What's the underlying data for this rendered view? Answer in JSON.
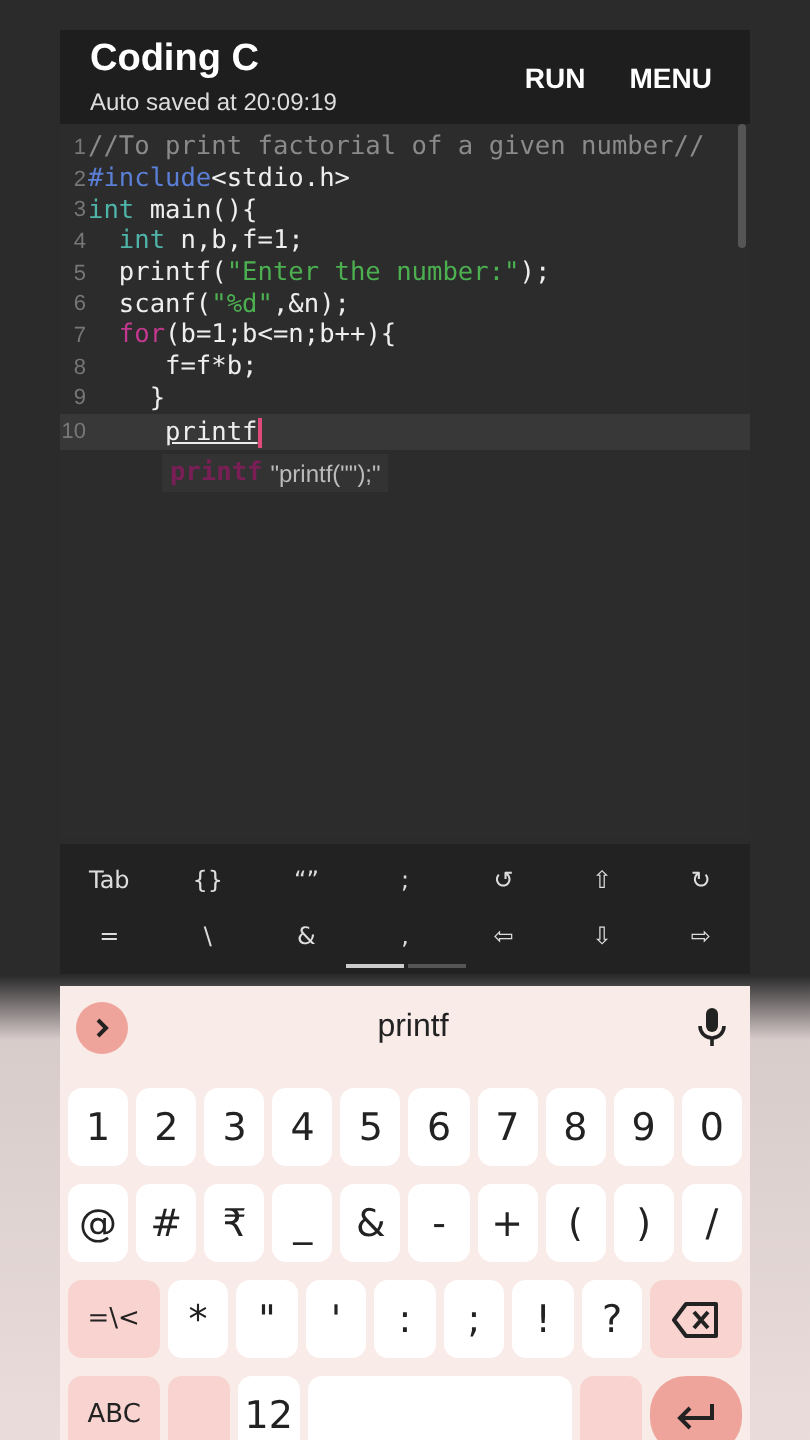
{
  "app_bar": {
    "title": "Coding C",
    "subtitle": "Auto saved at 20:09:19",
    "actions": [
      "RUN",
      "MENU"
    ]
  },
  "editor": {
    "lines": [
      {
        "number": "1",
        "current": false,
        "tokens": [
          {
            "text": "//To print factorial of a given number//",
            "kind": "comment"
          }
        ]
      },
      {
        "number": "2",
        "current": false,
        "tokens": [
          {
            "text": "#include",
            "kind": "preprocessor"
          },
          {
            "text": "<stdio.h>",
            "kind": "plain"
          }
        ]
      },
      {
        "number": "3",
        "current": false,
        "tokens": [
          {
            "text": "int",
            "kind": "type"
          },
          {
            "text": " main(){",
            "kind": "plain"
          }
        ]
      },
      {
        "number": "4",
        "current": false,
        "tokens": [
          {
            "text": "  int",
            "kind": "type"
          },
          {
            "text": " n,b,f=1;",
            "kind": "plain"
          }
        ]
      },
      {
        "number": "5",
        "current": false,
        "tokens": [
          {
            "text": "  printf(",
            "kind": "plain"
          },
          {
            "text": "\"Enter the number:\"",
            "kind": "string"
          },
          {
            "text": ");",
            "kind": "plain"
          }
        ]
      },
      {
        "number": "6",
        "current": false,
        "tokens": [
          {
            "text": "  scanf(",
            "kind": "plain"
          },
          {
            "text": "\"%d\"",
            "kind": "string"
          },
          {
            "text": ",&n);",
            "kind": "plain"
          }
        ]
      },
      {
        "number": "7",
        "current": false,
        "tokens": [
          {
            "text": "  for",
            "kind": "control"
          },
          {
            "text": "(b=1;b<=n;b++){",
            "kind": "plain"
          }
        ]
      },
      {
        "number": "8",
        "current": false,
        "tokens": [
          {
            "text": "     f=f*b;",
            "kind": "plain"
          }
        ]
      },
      {
        "number": "9",
        "current": false,
        "tokens": [
          {
            "text": "    }",
            "kind": "plain"
          }
        ]
      },
      {
        "number": "10",
        "current": true,
        "tokens": [
          {
            "text": "     printf",
            "kind": "composing"
          }
        ]
      }
    ],
    "suggestion": {
      "keyword": "printf",
      "template": "\"printf(\"\");\""
    }
  },
  "extra_keys": [
    [
      "Tab",
      "{}",
      "“”",
      ";",
      "↺",
      "⇧",
      "↻"
    ],
    [
      "=",
      "\\",
      "&",
      ",",
      "⇦",
      "⇩",
      "⇨"
    ]
  ],
  "extra_key_pages": [
    {
      "selected": true
    },
    {
      "selected": false
    }
  ],
  "keyboard": {
    "suggestion": "printf",
    "rows": [
      [
        {
          "label": "1",
          "kind": "char"
        },
        {
          "label": "2",
          "kind": "char"
        },
        {
          "label": "3",
          "kind": "char"
        },
        {
          "label": "4",
          "kind": "char"
        },
        {
          "label": "5",
          "kind": "char"
        },
        {
          "label": "6",
          "kind": "char"
        },
        {
          "label": "7",
          "kind": "char"
        },
        {
          "label": "8",
          "kind": "char"
        },
        {
          "label": "9",
          "kind": "char"
        },
        {
          "label": "0",
          "kind": "char"
        }
      ],
      [
        {
          "label": "@",
          "kind": "char"
        },
        {
          "label": "#",
          "kind": "char"
        },
        {
          "label": "₹",
          "kind": "char"
        },
        {
          "label": "_",
          "kind": "char"
        },
        {
          "label": "&",
          "kind": "char"
        },
        {
          "label": "-",
          "kind": "char"
        },
        {
          "label": "+",
          "kind": "char"
        },
        {
          "label": "(",
          "kind": "char"
        },
        {
          "label": ")",
          "kind": "char"
        },
        {
          "label": "/",
          "kind": "char"
        }
      ],
      [
        {
          "label": "=\\<",
          "kind": "function"
        },
        {
          "label": "*",
          "kind": "char"
        },
        {
          "label": "\"",
          "kind": "char"
        },
        {
          "label": "'",
          "kind": "char"
        },
        {
          "label": ":",
          "kind": "char"
        },
        {
          "label": ";",
          "kind": "char"
        },
        {
          "label": "!",
          "kind": "char"
        },
        {
          "label": "?",
          "kind": "char"
        },
        {
          "kind": "backspace"
        }
      ],
      [
        {
          "label": "ABC",
          "kind": "function"
        },
        {
          "kind": "blank"
        },
        {
          "label": "12",
          "kind": "char"
        },
        {
          "kind": "space"
        },
        {
          "kind": "blank"
        },
        {
          "kind": "enter"
        }
      ]
    ]
  }
}
